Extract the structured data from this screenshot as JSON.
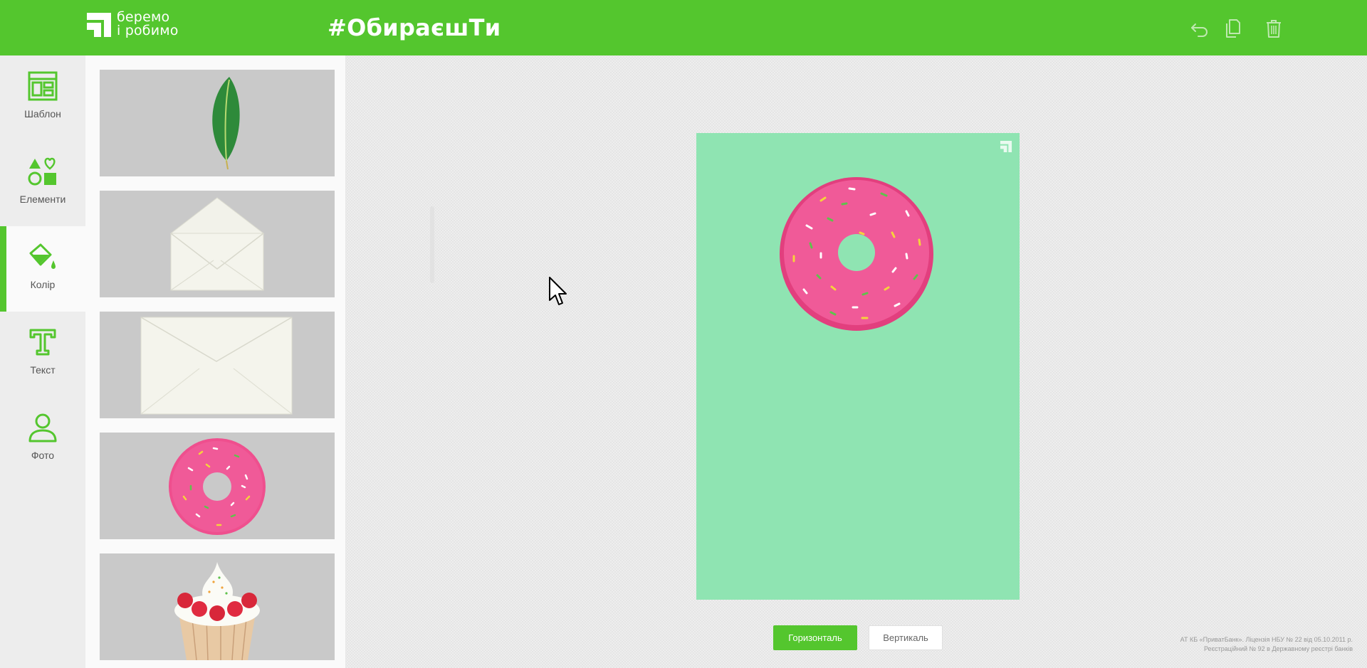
{
  "header": {
    "logo_line1": "беремо",
    "logo_line2": "і робимо",
    "hashtag": "#ОбираєшТи",
    "undo_icon": "undo-icon",
    "copy_icon": "copy-icon",
    "trash_icon": "trash-icon",
    "accent": "#54c62e"
  },
  "rail": {
    "items": [
      {
        "label": "Шаблон",
        "icon": "template-icon"
      },
      {
        "label": "Елементи",
        "icon": "shapes-icon"
      },
      {
        "label": "Колір",
        "icon": "paint-bucket-icon",
        "active": true
      },
      {
        "label": "Текст",
        "icon": "text-icon"
      },
      {
        "label": "Фото",
        "icon": "person-icon"
      }
    ]
  },
  "panel": {
    "thumbnails": [
      "leaf",
      "open-envelope",
      "closed-envelope",
      "pink-donut",
      "cupcake"
    ]
  },
  "canvas": {
    "background": "#8fe4b2",
    "element": "pink-donut"
  },
  "orientation": {
    "horizontal_label": "Горизонталь",
    "vertical_label": "Вертикаль",
    "selected": "horizontal"
  },
  "legal": {
    "line1": "АТ КБ «ПриватБанк». Ліцензія НБУ № 22 від 05.10.2011 р.",
    "line2": "Реєстраційний № 92 в Державному реєстрі банків"
  }
}
